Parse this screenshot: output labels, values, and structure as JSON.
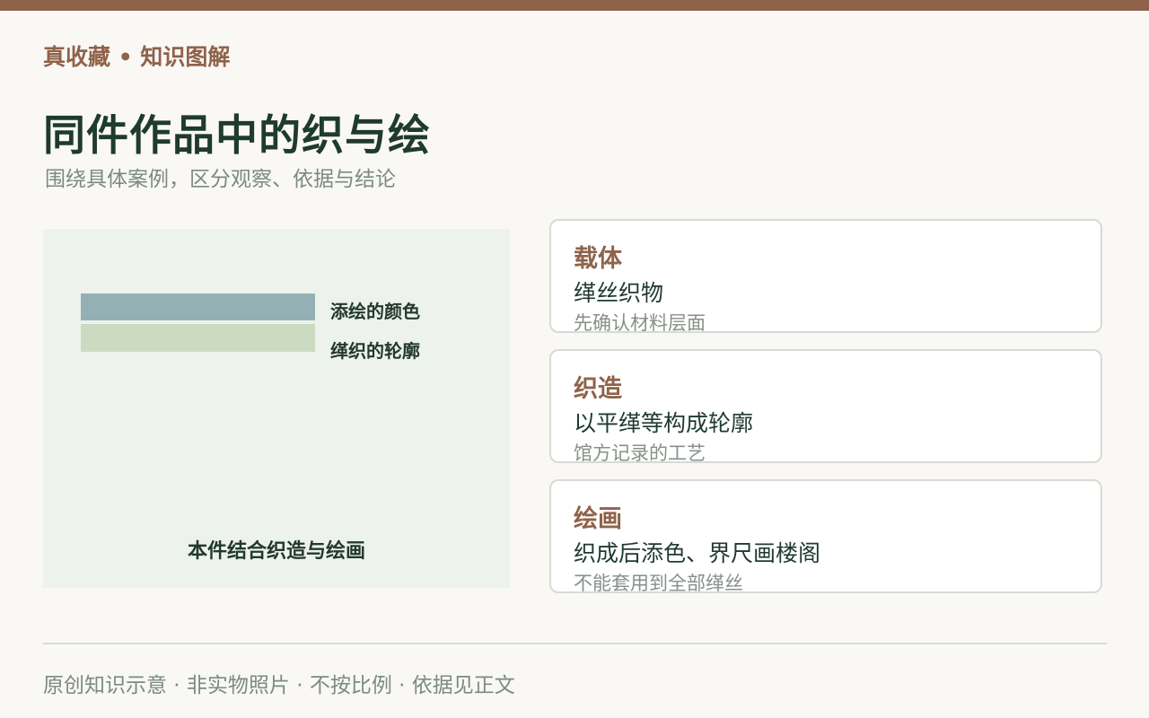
{
  "brand": "真收藏 • 知识图解",
  "title": "同件作品中的织与绘",
  "subtitle": "围绕具体案例，区分观察、依据与结论",
  "diagram": {
    "layers": [
      {
        "label": "添绘的颜色",
        "color": "#95b0b4"
      },
      {
        "label": "缂织的轮廓",
        "color": "#ccdac2"
      }
    ],
    "caption": "本件结合织造与绘画"
  },
  "cards": [
    {
      "title": "载体",
      "value": "缂丝织物",
      "note": "先确认材料层面"
    },
    {
      "title": "织造",
      "value": "以平缂等构成轮廓",
      "note": "馆方记录的工艺"
    },
    {
      "title": "绘画",
      "value": "织成后添色、界尺画楼阁",
      "note": "不能套用到全部缂丝"
    }
  ],
  "footer": "原创知识示意 · 非实物照片 · 不按比例 · 依据见正文",
  "colors": {
    "accent": "#8f624a",
    "heading": "#1f3a2e",
    "muted": "#7c8a84",
    "panel": "#eef2ec"
  }
}
